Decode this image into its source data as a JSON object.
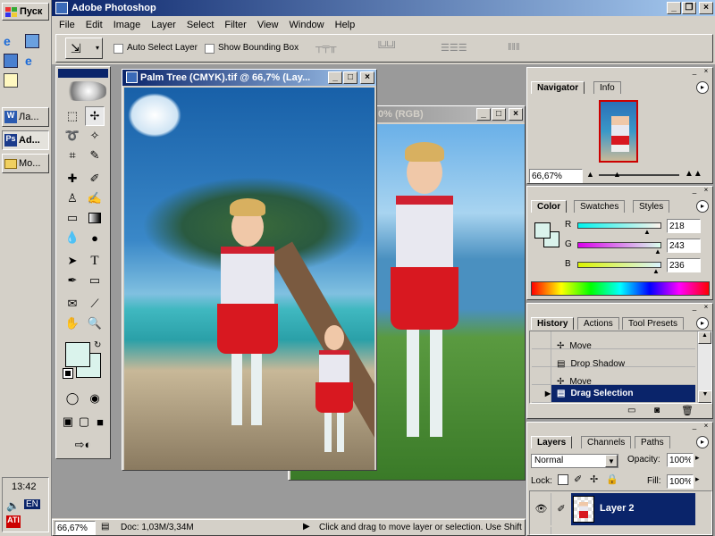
{
  "app": {
    "title": "Adobe Photoshop",
    "menu": [
      "File",
      "Edit",
      "Image",
      "Layer",
      "Select",
      "Filter",
      "View",
      "Window",
      "Help"
    ]
  },
  "taskbar": {
    "start": "Пуск",
    "items": [
      {
        "label": "Ла..."
      },
      {
        "label": "Ad..."
      },
      {
        "label": "Mo..."
      }
    ],
    "clock": "13:42",
    "lang": "EN"
  },
  "options": {
    "auto_select": "Auto Select Layer",
    "bounding_box": "Show Bounding Box"
  },
  "doc1": {
    "title": "Palm Tree (CMYK).tif @ 66,7% (Lay..."
  },
  "doc2": {
    "title": "0% (RGB)"
  },
  "navigator": {
    "tabs": [
      "Navigator",
      "Info"
    ],
    "zoom": "66,67%"
  },
  "color": {
    "tabs": [
      "Color",
      "Swatches",
      "Styles"
    ],
    "r_label": "R",
    "g_label": "G",
    "b_label": "B",
    "r": "218",
    "g": "243",
    "b": "236",
    "fg": "#daf3ec"
  },
  "history": {
    "tabs": [
      "History",
      "Actions",
      "Tool Presets"
    ],
    "items": [
      "Move",
      "Drop Shadow",
      "Move",
      "Drag Selection"
    ]
  },
  "layers": {
    "tabs": [
      "Layers",
      "Channels",
      "Paths"
    ],
    "mode": "Normal",
    "opacity_label": "Opacity:",
    "opacity": "100%",
    "lock_label": "Lock:",
    "fill_label": "Fill:",
    "fill": "100%",
    "layer_name": "Layer 2"
  },
  "status": {
    "zoom": "66,67%",
    "doc": "Doc: 1,03M/3,34M",
    "hint": "Click and drag to move layer or selection.  Use Shift"
  }
}
